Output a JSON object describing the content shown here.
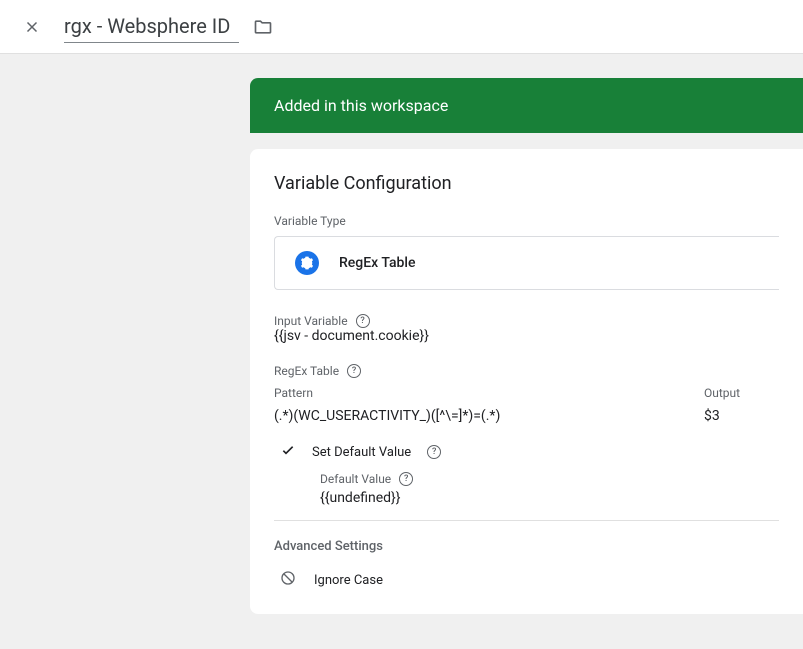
{
  "header": {
    "title_value": "rgx - Websphere ID"
  },
  "banner": {
    "text": "Added in this workspace"
  },
  "card": {
    "title": "Variable Configuration",
    "variable_type_label": "Variable Type",
    "variable_type_value": "RegEx Table",
    "input_variable_label": "Input Variable",
    "input_variable_value": "{{jsv - document.cookie}}",
    "regex_table_label": "RegEx Table",
    "table": {
      "pattern_header": "Pattern",
      "output_header": "Output",
      "pattern_value": "(.*)(WC_USERACTIVITY_)([^\\=]*)=(.*)",
      "output_value": "$3"
    },
    "set_default_label": "Set Default Value",
    "default_value_label": "Default Value",
    "default_value": "{{undefined}}",
    "advanced_label": "Advanced Settings",
    "ignore_case_label": "Ignore Case"
  }
}
